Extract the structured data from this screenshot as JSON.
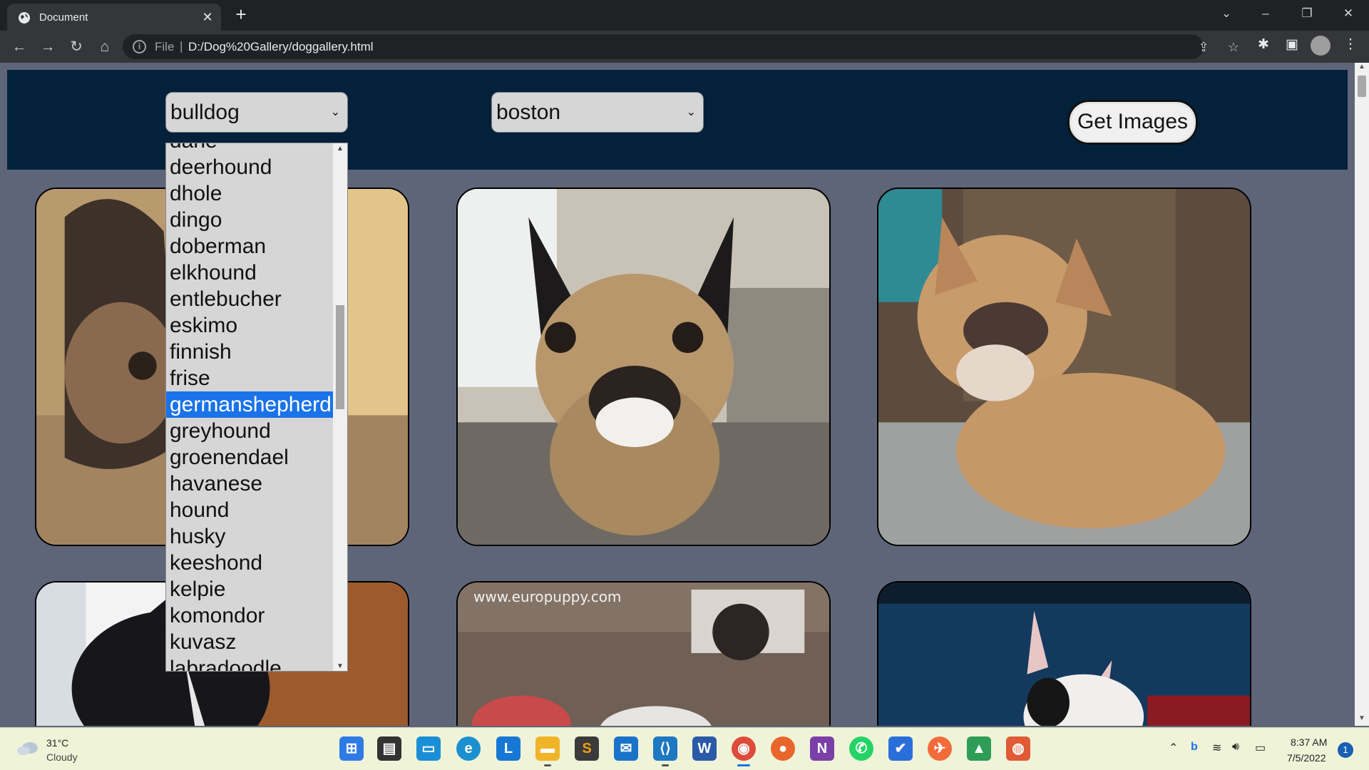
{
  "browser": {
    "tab_title": "Document",
    "tab_close": "✕",
    "new_tab": "+",
    "url_scheme": "File",
    "url_separator": "|",
    "url": "D:/Dog%20Gallery/doggallery.html"
  },
  "page": {
    "breed_select_value": "bulldog",
    "subbreed_select_value": "boston",
    "get_images_label": "Get Images",
    "dropdown_options": [
      "deerhound",
      "dhole",
      "dingo",
      "doberman",
      "elkhound",
      "entlebucher",
      "eskimo",
      "finnish",
      "frise",
      "germanshepherd",
      "greyhound",
      "groenendael",
      "havanese",
      "hound",
      "husky",
      "keeshond",
      "kelpie",
      "komondor",
      "kuvasz",
      "labradoodle"
    ],
    "dropdown_partial_top": "dane",
    "dropdown_highlighted": "germanshepherd",
    "watermark_text": "www.europuppy.com"
  },
  "taskbar": {
    "temperature": "31°C",
    "weather": "Cloudy",
    "time": "8:37 AM",
    "date": "7/5/2022",
    "notification_count": "1",
    "app_icons": [
      "windows-start",
      "task-view",
      "desktop",
      "edge",
      "l-app",
      "file-explorer",
      "sublime-text",
      "mail",
      "vscode",
      "word",
      "chrome",
      "firefox",
      "onenote",
      "whatsapp",
      "todo",
      "postman",
      "android-studio",
      "ubuntu-app"
    ]
  },
  "colors": {
    "page_bg": "#5f6578",
    "header_bg": "#03213a",
    "highlight": "#1a73e8",
    "select_bg": "#d6d6d6"
  }
}
